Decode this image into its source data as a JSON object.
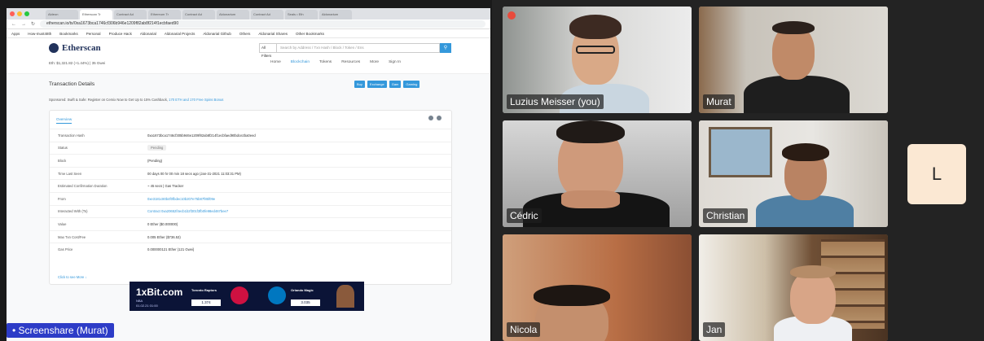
{
  "browser": {
    "tabs": [
      "Aldeon",
      "Etherscan Tr",
      "Contract Ad",
      "Ethereum Tr",
      "Contract Ad",
      "Aldonarium",
      "Contract Ad",
      "Seals • Eth",
      "Aldonarium"
    ],
    "address": "etherscan.io/tx/0xa1673bca1746cf306b946e1209f82ab8f214f1ecbfaed90",
    "bookmarks": [
      "Apps",
      "How-must48th",
      "Bookmarks",
      "Personal",
      "Produce Hack",
      "Aldonarial",
      "Aldonarial Projects",
      "Aldonarial Github",
      "Others",
      "Aldonarial Shares",
      "Other Bookmarks"
    ]
  },
  "etherscan": {
    "logo": "Etherscan",
    "eth_price": "Eth: $1,321.82 (+1.44%) | 35 Gwei",
    "filter": "All Filters",
    "search_placeholder": "Search by Address / Txn Hash / Block / Token / Ens",
    "nav": [
      "Home",
      "Blockchain",
      "Tokens",
      "Resources",
      "More",
      "Sign In"
    ],
    "page_title": "Transaction Details",
    "pills": [
      "Buy",
      "Exchange",
      "Gam",
      "Gaming"
    ],
    "sponsored_prefix": "Sponsored:",
    "sponsored_text": "Swift & Safe: Register on Cemix Now to Get Up to 15% Cashback,",
    "sponsored_link": "170 ETH and 170 Free Spins Bonus",
    "overview_tab": "Overview",
    "rows": [
      {
        "label": "Transaction Hash",
        "value": "0xa1673bca1746cf305b946e1209f82ab8f214f1ecbfaed90bdce2ba0eed",
        "type": "text"
      },
      {
        "label": "Status",
        "value": "Pending",
        "type": "badge"
      },
      {
        "label": "Block",
        "value": "(Pending)",
        "type": "text"
      },
      {
        "label": "Time Last Seen",
        "value": "00 days 00 hr 00 min 18 secs ago (Jan-31-2021 11:03:31 PM)",
        "type": "text"
      },
      {
        "label": "Estimated Confirmation Duration",
        "value": "~ 45 secs | Gas Tracker",
        "type": "text"
      },
      {
        "label": "From",
        "value": "0xe3181c80b4f0fbdec10b207e75b87f85f09e",
        "type": "link"
      },
      {
        "label": "Interacted With (To)",
        "value": "Contract 0xa20652f4ecb1b2f301f3fb0fe98ed467bee7",
        "type": "link"
      },
      {
        "label": "Value",
        "value": "0 Ether ($0.000000)",
        "type": "text"
      },
      {
        "label": "Max Txn Cost/Fee",
        "value": "0.005 Ether ($736.53)",
        "type": "text"
      },
      {
        "label": "Gas Price",
        "value": "0.000000121 Ether (121 Gwei)",
        "type": "text"
      }
    ],
    "click_more": "Click to see More ↓"
  },
  "ad": {
    "brand": "1xBit.com",
    "league": "NBA",
    "date": "01.02.21 01:00",
    "team1": "Toronto Raptors",
    "team2": "Orlando Magic",
    "odds1": "1.374",
    "odds2": "3.035",
    "colors": {
      "team1": "#ce1141",
      "team2": "#0077c0"
    }
  },
  "screenshare_label": "Screenshare (Murat)",
  "participants": [
    {
      "name": "Luzius Meisser (you)",
      "recording": true
    },
    {
      "name": "Murat"
    },
    {
      "name": "Cédric"
    },
    {
      "name": "Christian"
    },
    {
      "name": "Nicola"
    },
    {
      "name": "Jan"
    }
  ],
  "avatar_initial": "L",
  "colors": {
    "accent": "#3498db",
    "brand": "#21325b",
    "label_bg": "#2d3cc7",
    "avatar_bg": "#fbe8d3",
    "rec": "#e84b3c"
  }
}
